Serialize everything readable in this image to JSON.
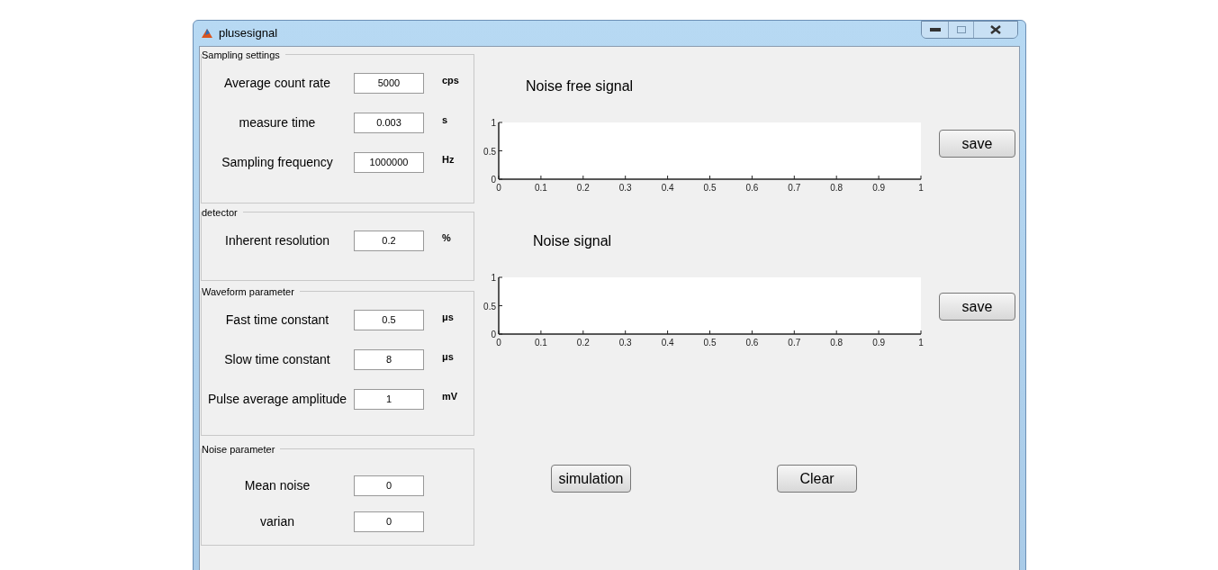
{
  "window": {
    "title": "plusesignal"
  },
  "panels": [
    {
      "title": "Sampling settings",
      "fields": [
        {
          "label": "Average count rate",
          "value": "5000",
          "unit": "cps"
        },
        {
          "label": "measure time",
          "value": "0.003",
          "unit": "s"
        },
        {
          "label": "Sampling frequency",
          "value": "1000000",
          "unit": "Hz"
        }
      ]
    },
    {
      "title": "detector",
      "fields": [
        {
          "label": "Inherent resolution",
          "value": "0.2",
          "unit": "%"
        }
      ]
    },
    {
      "title": "Waveform parameter",
      "fields": [
        {
          "label": "Fast time constant",
          "value": "0.5",
          "unit": "μs"
        },
        {
          "label": "Slow time constant",
          "value": "8",
          "unit": "μs"
        },
        {
          "label": "Pulse average amplitude",
          "value": "1",
          "unit": "mV"
        }
      ]
    },
    {
      "title": "Noise parameter",
      "fields": [
        {
          "label": "Mean noise",
          "value": "0"
        },
        {
          "label": "varian",
          "value": "0"
        }
      ]
    }
  ],
  "plots": [
    {
      "title": "Noise free signal",
      "button": "save",
      "chart_data": {
        "type": "line",
        "xlim": [
          0,
          1
        ],
        "ylim": [
          0,
          1
        ],
        "xticks": [
          0,
          0.1,
          0.2,
          0.3,
          0.4,
          0.5,
          0.6,
          0.7,
          0.8,
          0.9,
          1
        ],
        "yticks": [
          0,
          0.5,
          1
        ]
      }
    },
    {
      "title": "Noise signal",
      "button": "save",
      "chart_data": {
        "type": "line",
        "xlim": [
          0,
          1
        ],
        "ylim": [
          0,
          1
        ],
        "xticks": [
          0,
          0.1,
          0.2,
          0.3,
          0.4,
          0.5,
          0.6,
          0.7,
          0.8,
          0.9,
          1
        ],
        "yticks": [
          0,
          0.5,
          1
        ]
      }
    }
  ],
  "buttons": [
    "simulation",
    "Clear"
  ]
}
